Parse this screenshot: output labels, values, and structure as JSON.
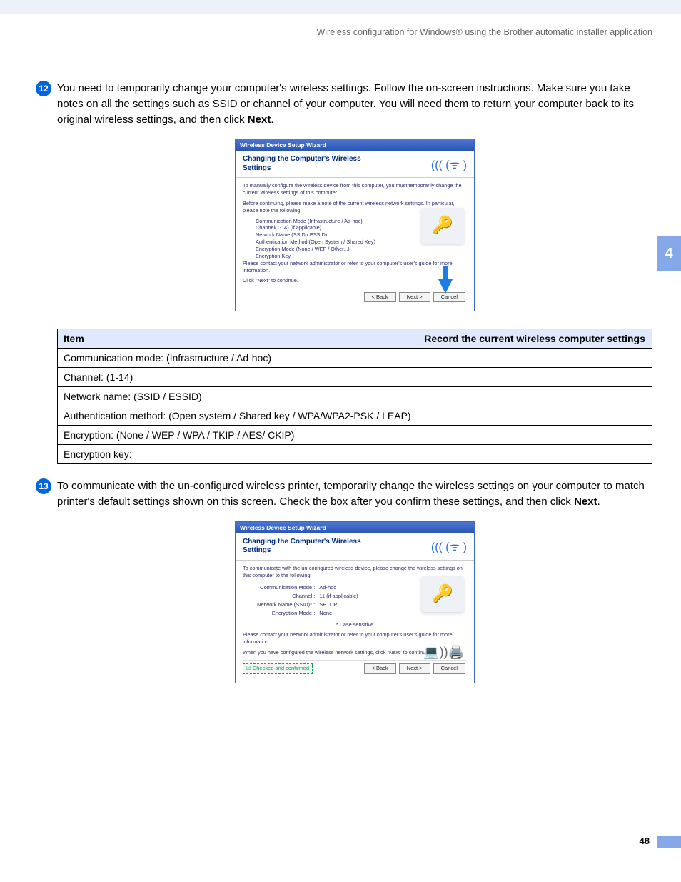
{
  "header": "Wireless configuration for Windows® using the Brother automatic installer application",
  "sideTab": "4",
  "pageNum": "48",
  "step12": {
    "num": "12",
    "text1": "You need to temporarily change your computer's wireless settings. Follow the on-screen instructions. Make sure you take notes on all the settings such as SSID or channel of your computer. You will need them to return your computer back to its original wireless settings, and then click ",
    "bold": "Next",
    "text2": "."
  },
  "dialog1": {
    "title": "Wireless Device Setup Wizard",
    "heading": "Changing the Computer's Wireless Settings",
    "p1": "To manually configure the wireless device from this computer, you must temporarily change the current wireless settings of this computer.",
    "p2": "Before continuing, please make a note of the current wireless network settings. In particular, please note the following:",
    "items": [
      "Communication Mode (Infrastructure / Ad-hoc)",
      "Channel(1-14) (if applicable)",
      "Network Name (SSID / ESSID)",
      "Authentication Method (Open System / Shared Key)",
      "Encryption Mode (None / WEP / Other...)",
      "Encryption Key"
    ],
    "p3": "Please contact your network administrator or refer to your computer's user's guide for more information.",
    "p4": "Click \"Next\" to continue.",
    "buttons": {
      "back": "< Back",
      "next": "Next >",
      "cancel": "Cancel"
    }
  },
  "table": {
    "h1": "Item",
    "h2": "Record the current wireless computer settings",
    "rows": [
      "Communication mode: (Infrastructure / Ad-hoc)",
      "Channel: (1-14)",
      "Network name: (SSID / ESSID)",
      "Authentication method: (Open system / Shared key / WPA/WPA2-PSK / LEAP)",
      "Encryption: (None / WEP / WPA / TKIP / AES/ CKIP)",
      "Encryption key:"
    ]
  },
  "step13": {
    "num": "13",
    "text1": "To communicate with the un-configured wireless printer, temporarily change the wireless settings on your computer to match printer's default settings shown on this screen. Check the box after you confirm these settings, and then click ",
    "bold": "Next",
    "text2": "."
  },
  "dialog2": {
    "title": "Wireless Device Setup Wizard",
    "heading": "Changing the Computer's Wireless Settings",
    "p1": "To communicate with the un-configured wireless device, please change the wireless settings on this computer to the following:",
    "rows": [
      [
        "Communication Mode :",
        "Ad-hoc"
      ],
      [
        "Channel :",
        "11   (if applicable)"
      ],
      [
        "Network Name (SSID)* :",
        "SETUP"
      ],
      [
        "Encryption Mode :",
        "None"
      ]
    ],
    "note": "* Case sensitive",
    "p2": "Please contact your network administrator or refer to your computer's user's guide for more information.",
    "p3": "When you have configured the wireless network settings, click \"Next\" to continue.",
    "checkbox": "☑ Checked and confirmed",
    "buttons": {
      "back": "< Back",
      "next": "Next >",
      "cancel": "Cancel"
    }
  }
}
